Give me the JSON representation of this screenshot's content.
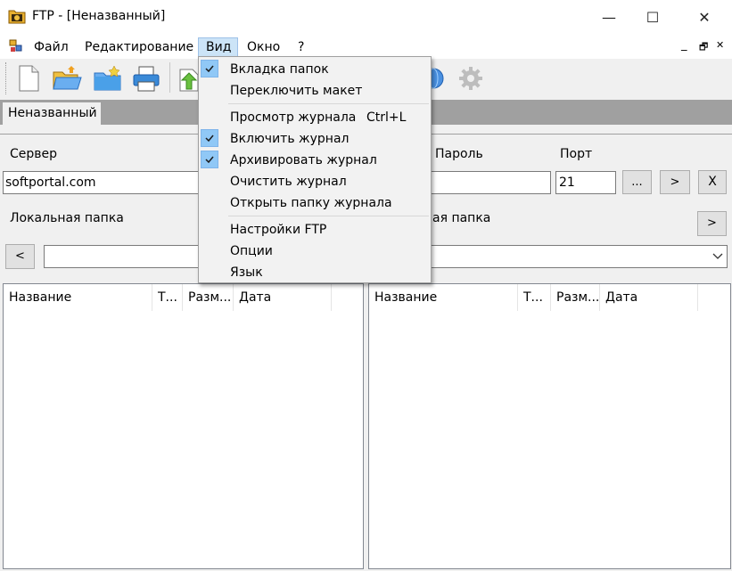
{
  "window": {
    "title": "FTP - [Неназванный]"
  },
  "controls": {
    "minimize": "—",
    "maximize": "☐",
    "close": "✕"
  },
  "menubar": {
    "items": [
      {
        "label": "Файл"
      },
      {
        "label": "Редактирование"
      },
      {
        "label": "Вид"
      },
      {
        "label": "Окно"
      },
      {
        "label": "?"
      }
    ],
    "mdi_min": "_",
    "mdi_restore": "🗗",
    "mdi_close": "✕"
  },
  "toolbar": {
    "icons": [
      "new-file-icon",
      "open-folder-icon",
      "new-folder-icon",
      "print-icon",
      "upload-icon",
      "globe-icon",
      "settings-gear-icon"
    ]
  },
  "tabs": [
    {
      "label": "Неназванный"
    }
  ],
  "form": {
    "server_label": "Сервер",
    "server_value": "softportal.com",
    "password_label": "Пароль",
    "password_value": "",
    "port_label": "Порт",
    "port_value": "21",
    "browse_btn": "...",
    "connect_btn": ">",
    "disconnect_btn": "X",
    "local_folder_label": "Локальная папка",
    "remote_folder_label": "ая папка",
    "back_btn": "<",
    "remote_go_btn": ">"
  },
  "left_list": {
    "columns": [
      "Название",
      "Т...",
      "Разм...",
      "Дата"
    ]
  },
  "right_list": {
    "columns": [
      "Название",
      "Т...",
      "Разм...",
      "Дата"
    ]
  },
  "dropdown": {
    "items": [
      {
        "label": "Вкладка папок",
        "checked": true
      },
      {
        "label": "Переключить макет",
        "checked": false
      },
      {
        "label": "Просмотр журнала",
        "shortcut": "Ctrl+L",
        "checked": false
      },
      {
        "label": "Включить журнал",
        "checked": true
      },
      {
        "label": "Архивировать журнал",
        "checked": true
      },
      {
        "label": "Очистить журнал",
        "checked": false
      },
      {
        "label": "Открыть папку журнала",
        "checked": false
      },
      {
        "label": "Настройки FTP",
        "checked": false
      },
      {
        "label": "Опции",
        "checked": false
      },
      {
        "label": "Язык",
        "checked": false
      }
    ],
    "check_glyph": "✔"
  }
}
